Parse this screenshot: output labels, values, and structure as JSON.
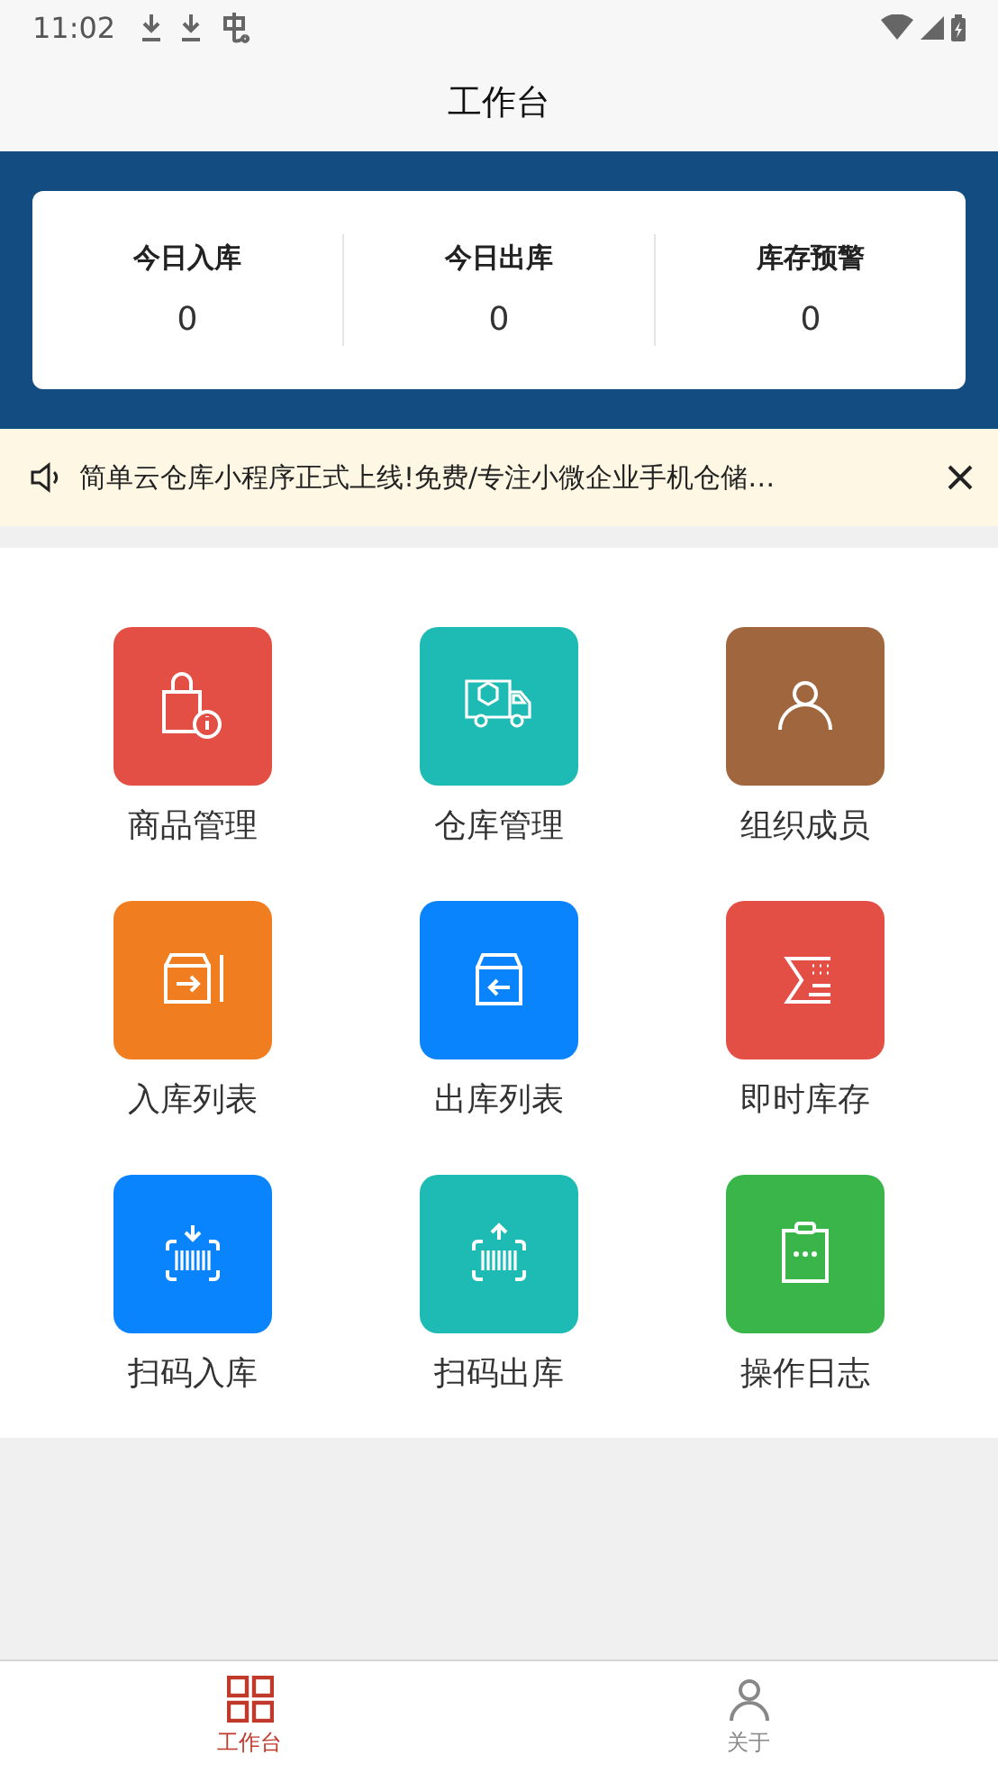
{
  "status_bar": {
    "time": "11:02"
  },
  "header": {
    "title": "工作台"
  },
  "stats": [
    {
      "label": "今日入库",
      "value": "0"
    },
    {
      "label": "今日出库",
      "value": "0"
    },
    {
      "label": "库存预警",
      "value": "0"
    }
  ],
  "notice": {
    "text": "简单云仓库小程序正式上线!免费/专注小微企业手机仓储…"
  },
  "tiles": [
    {
      "label": "商品管理",
      "color": "#e34f44",
      "kind": "bag"
    },
    {
      "label": "仓库管理",
      "color": "#1dbbb4",
      "kind": "truck"
    },
    {
      "label": "组织成员",
      "color": "#a0663e",
      "kind": "person"
    },
    {
      "label": "入库列表",
      "color": "#f07d1f",
      "kind": "box-in"
    },
    {
      "label": "出库列表",
      "color": "#0a84fc",
      "kind": "box-out"
    },
    {
      "label": "即时库存",
      "color": "#e34f44",
      "kind": "sigma"
    },
    {
      "label": "扫码入库",
      "color": "#0a84fc",
      "kind": "scan-in"
    },
    {
      "label": "扫码出库",
      "color": "#1dbbb4",
      "kind": "scan-out"
    },
    {
      "label": "操作日志",
      "color": "#39b54a",
      "kind": "clipboard"
    }
  ],
  "tab_bar": [
    {
      "label": "工作台",
      "selected": true,
      "kind": "grid"
    },
    {
      "label": "关于",
      "selected": false,
      "kind": "person"
    }
  ]
}
